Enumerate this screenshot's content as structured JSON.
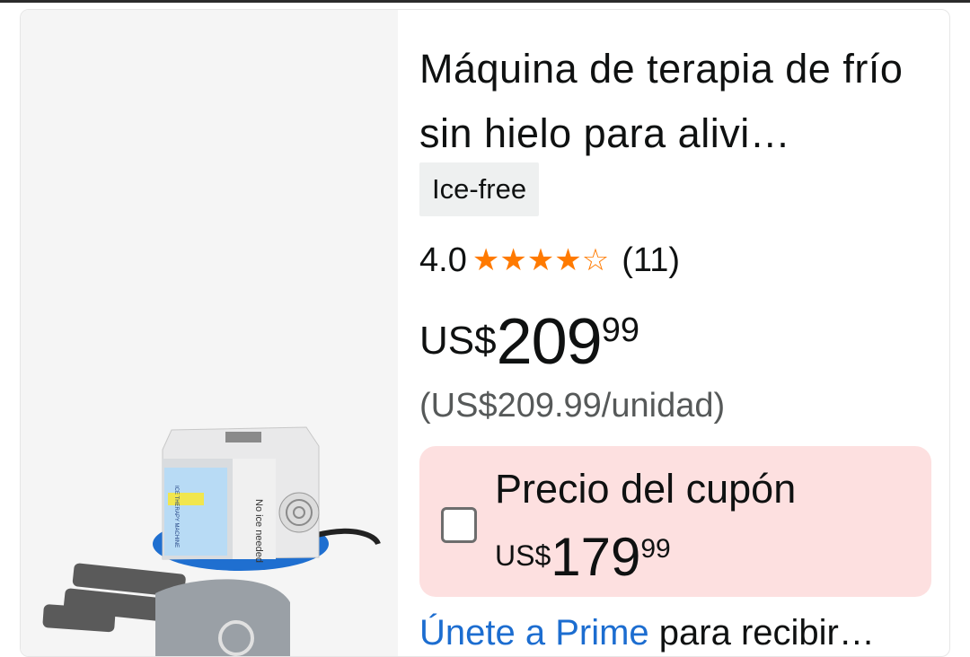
{
  "product": {
    "title": "Máquina de terapia de frío sin hielo para alivi…",
    "badge": "Ice-free",
    "rating": "4.0",
    "stars": 4,
    "review_count": "(11)",
    "price": {
      "currency": "US$",
      "whole": "209",
      "fraction": "99"
    },
    "unit_price": "(US$209.99/unidad)",
    "coupon": {
      "label": "Precio del cupón",
      "currency": "US$",
      "whole": "179",
      "fraction": "99"
    },
    "prime": {
      "link_text": "Únete a Prime",
      "rest_text": " para recibir…"
    },
    "image_text": {
      "machine_label": "ICE THERAPY MACHINE",
      "side_label": "No ice needed"
    }
  },
  "colors": {
    "star": "#ff7a00",
    "coupon_bg": "#fde0e0",
    "link": "#1c6dd0",
    "image_bg": "#f5f5f5"
  }
}
